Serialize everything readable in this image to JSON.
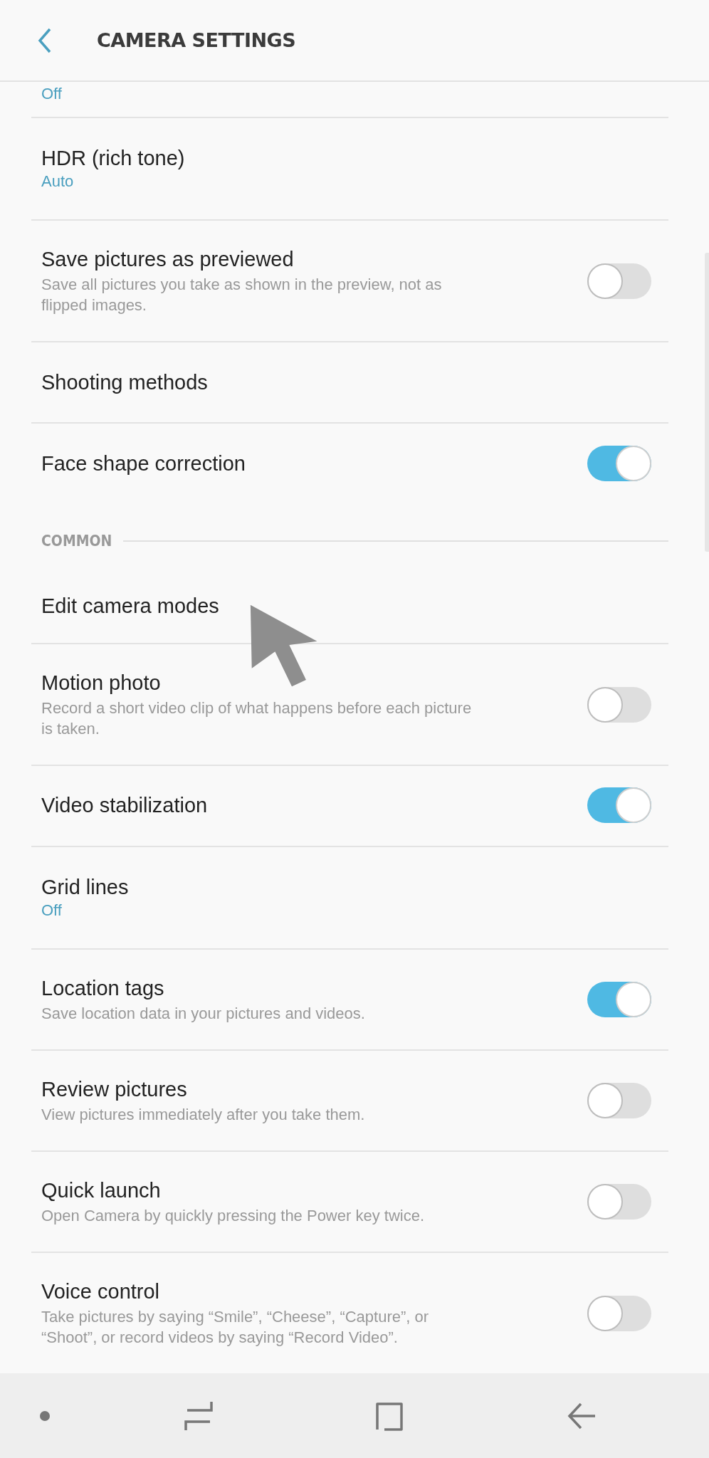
{
  "header": {
    "title": "CAMERA SETTINGS"
  },
  "rows": [
    {
      "kind": "partial",
      "value": "Off"
    },
    {
      "kind": "value",
      "title": "HDR (rich tone)",
      "value": "Auto"
    },
    {
      "kind": "toggle",
      "title": "Save pictures as previewed",
      "description": "Save all pictures you take as shown in the preview, not as flipped images.",
      "on": false
    },
    {
      "kind": "link",
      "title": "Shooting methods"
    },
    {
      "kind": "toggle",
      "title": "Face shape correction",
      "on": true
    },
    {
      "kind": "section",
      "title": "COMMON"
    },
    {
      "kind": "link",
      "title": "Edit camera modes"
    },
    {
      "kind": "toggle",
      "title": "Motion photo",
      "description": "Record a short video clip of what happens before each picture is taken.",
      "on": false
    },
    {
      "kind": "toggle",
      "title": "Video stabilization",
      "on": true
    },
    {
      "kind": "value",
      "title": "Grid lines",
      "value": "Off"
    },
    {
      "kind": "toggle",
      "title": "Location tags",
      "description": "Save location data in your pictures and videos.",
      "on": true
    },
    {
      "kind": "toggle",
      "title": "Review pictures",
      "description": "View pictures immediately after you take them.",
      "on": false
    },
    {
      "kind": "toggle",
      "title": "Quick launch",
      "description": "Open Camera by quickly pressing the Power key twice.",
      "on": false
    },
    {
      "kind": "toggle",
      "title": "Voice control",
      "description": "Take pictures by saying “Smile”, “Cheese”, “Capture”, or “Shoot”, or record videos by saying “Record Video”.",
      "on": false
    }
  ]
}
